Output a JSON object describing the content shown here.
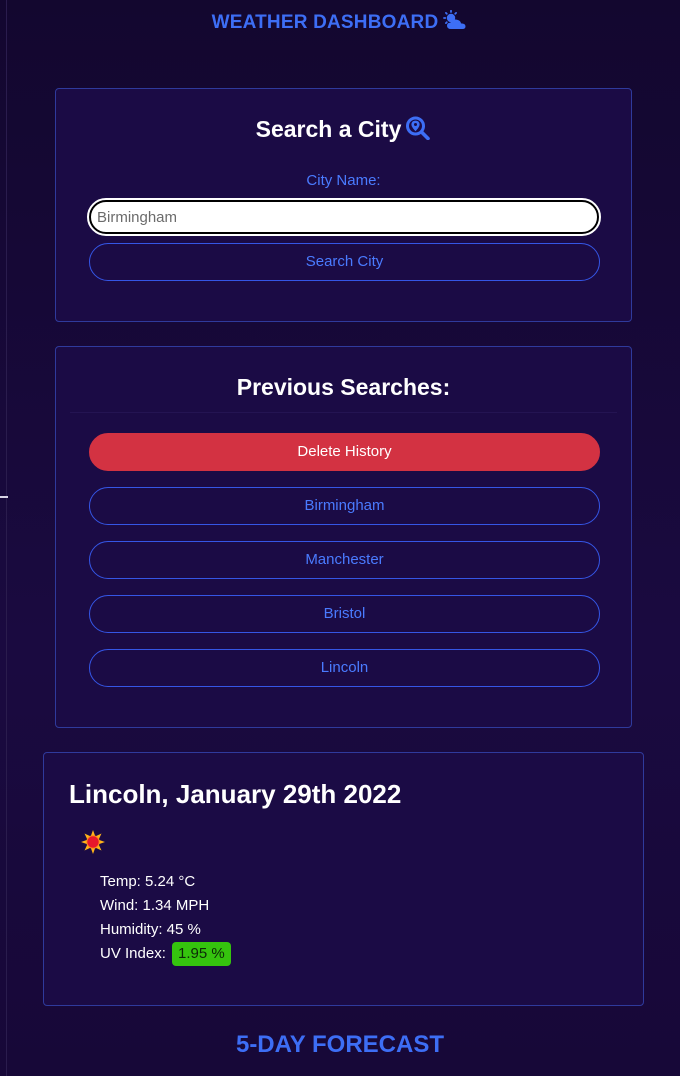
{
  "header": {
    "title": "WEATHER DASHBOARD",
    "icon": "sun-behind-cloud-icon",
    "color": "#3d6ef5"
  },
  "search": {
    "title": "Search a City",
    "title_icon": "search-location-icon",
    "label": "City Name:",
    "input_value": "Birmingham",
    "button_label": "Search City"
  },
  "history": {
    "title": "Previous Searches:",
    "delete_label": "Delete History",
    "delete_color": "#d33242",
    "items": [
      {
        "label": "Birmingham"
      },
      {
        "label": "Manchester"
      },
      {
        "label": "Bristol"
      },
      {
        "label": "Lincoln"
      }
    ]
  },
  "current": {
    "title": "Lincoln, January 29th 2022",
    "icon": "sun-icon",
    "temp": "Temp: 5.24 °C",
    "wind": "Wind: 1.34 MPH",
    "humidity": "Humidity: 45 %",
    "uv_label": "UV Index:",
    "uv_value": "1.95 %",
    "uv_color": "#35c40e"
  },
  "forecast": {
    "title": "5-DAY FORECAST"
  }
}
